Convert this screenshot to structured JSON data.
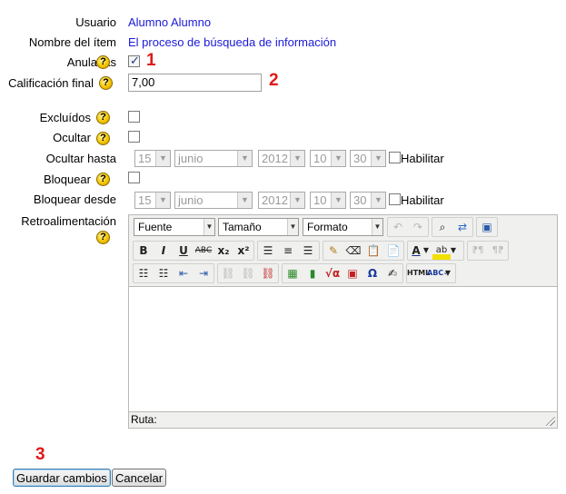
{
  "form": {
    "usuario_label": "Usuario",
    "usuario_value": "Alumno Alumno",
    "item_label": "Nombre del ítem",
    "item_value": "El proceso de búsqueda de información",
    "anuladas_label": "Anuladas",
    "anuladas_checked": true,
    "calificacion_label": "Calificación final",
    "calificacion_value": "7,00",
    "excluidos_label": "Excluídos",
    "ocultar_label": "Ocultar",
    "ocultar_hasta_label": "Ocultar hasta",
    "bloquear_label": "Bloquear",
    "bloquear_desde_label": "Bloquear desde",
    "retro_label": "Retroalimentación",
    "help_glyph": "?"
  },
  "dates": {
    "ocultar_hasta": {
      "day": "15",
      "month": "junio",
      "year": "2012",
      "hour": "10",
      "minute": "30",
      "enable_label": "Habilitar"
    },
    "bloquear_desde": {
      "day": "15",
      "month": "junio",
      "year": "2012",
      "hour": "10",
      "minute": "30",
      "enable_label": "Habilitar"
    }
  },
  "editor": {
    "font_select": "Fuente",
    "size_select": "Tamaño",
    "format_select": "Formato",
    "path_label": "Ruta:"
  },
  "annotations": {
    "one": "1",
    "two": "2",
    "three": "3"
  },
  "buttons": {
    "save": "Guardar cambios",
    "cancel": "Cancelar"
  }
}
